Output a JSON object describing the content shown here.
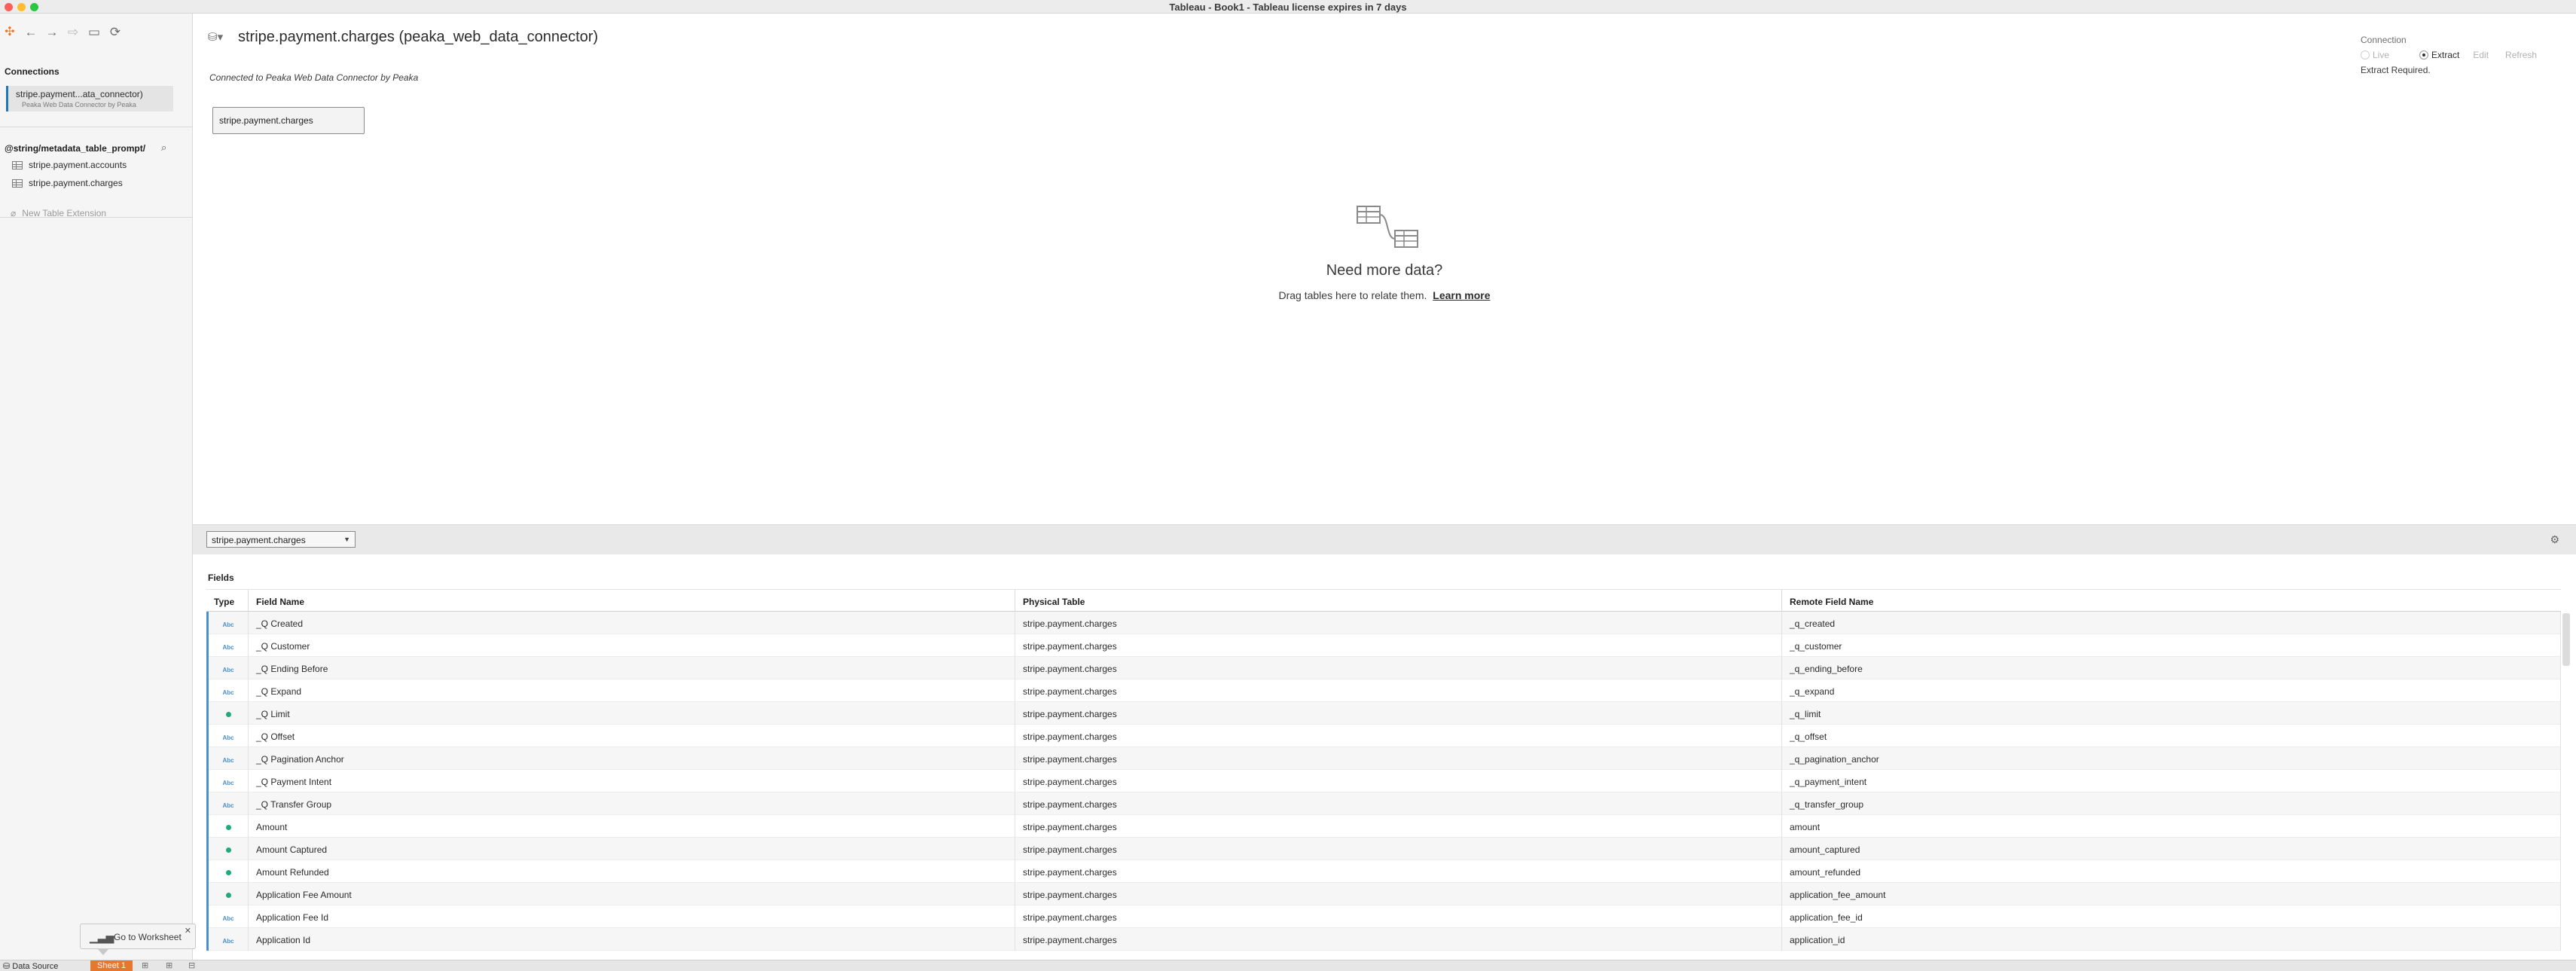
{
  "window": {
    "title": "Tableau - Book1 - Tableau license expires in 7 days"
  },
  "toolbar": {
    "icons": [
      "tableau-logo-icon",
      "back-icon",
      "forward-icon",
      "redo-icon",
      "save-icon",
      "refresh-icon"
    ]
  },
  "sidebar": {
    "connections_label": "Connections",
    "connection": {
      "name": "stripe.payment...ata_connector)",
      "subtitle": "Peaka Web Data Connector by Peaka"
    },
    "database_label": "@string/metadata_table_prompt/",
    "tables": [
      {
        "label": "stripe.payment.accounts"
      },
      {
        "label": "stripe.payment.charges"
      }
    ],
    "new_extension_label": "New Table Extension"
  },
  "header": {
    "title": "stripe.payment.charges (peaka_web_data_connector)",
    "connected_to": "Connected to Peaka Web Data Connector by Peaka"
  },
  "connection_panel": {
    "label": "Connection",
    "live": "Live",
    "extract": "Extract",
    "edit": "Edit",
    "refresh": "Refresh",
    "selected": "Extract",
    "status": "Extract Required."
  },
  "canvas": {
    "table_card": "stripe.payment.charges",
    "empty_title": "Need more data?",
    "empty_sub": "Drag tables here to relate them.",
    "learn_more": "Learn more"
  },
  "grid": {
    "table_select": "stripe.payment.charges",
    "fields_label": "Fields",
    "columns": [
      "Type",
      "Field Name",
      "Physical Table",
      "Remote Field Name"
    ],
    "rows": [
      {
        "type": "Abc",
        "field": "_Q Created",
        "physical": "stripe.payment.charges",
        "remote": "_q_created"
      },
      {
        "type": "Abc",
        "field": "_Q Customer",
        "physical": "stripe.payment.charges",
        "remote": "_q_customer"
      },
      {
        "type": "Abc",
        "field": "_Q Ending Before",
        "physical": "stripe.payment.charges",
        "remote": "_q_ending_before"
      },
      {
        "type": "Abc",
        "field": "_Q Expand",
        "physical": "stripe.payment.charges",
        "remote": "_q_expand"
      },
      {
        "type": "#",
        "field": "_Q Limit",
        "physical": "stripe.payment.charges",
        "remote": "_q_limit"
      },
      {
        "type": "Abc",
        "field": "_Q Offset",
        "physical": "stripe.payment.charges",
        "remote": "_q_offset"
      },
      {
        "type": "Abc",
        "field": "_Q Pagination Anchor",
        "physical": "stripe.payment.charges",
        "remote": "_q_pagination_anchor"
      },
      {
        "type": "Abc",
        "field": "_Q Payment Intent",
        "physical": "stripe.payment.charges",
        "remote": "_q_payment_intent"
      },
      {
        "type": "Abc",
        "field": "_Q Transfer Group",
        "physical": "stripe.payment.charges",
        "remote": "_q_transfer_group"
      },
      {
        "type": "#",
        "field": "Amount",
        "physical": "stripe.payment.charges",
        "remote": "amount"
      },
      {
        "type": "#",
        "field": "Amount Captured",
        "physical": "stripe.payment.charges",
        "remote": "amount_captured"
      },
      {
        "type": "#",
        "field": "Amount Refunded",
        "physical": "stripe.payment.charges",
        "remote": "amount_refunded"
      },
      {
        "type": "#",
        "field": "Application Fee Amount",
        "physical": "stripe.payment.charges",
        "remote": "application_fee_amount"
      },
      {
        "type": "Abc",
        "field": "Application Fee Id",
        "physical": "stripe.payment.charges",
        "remote": "application_fee_id"
      },
      {
        "type": "Abc",
        "field": "Application Id",
        "physical": "stripe.payment.charges",
        "remote": "application_id"
      }
    ]
  },
  "tooltip": {
    "text": "Go to Worksheet"
  },
  "bottom_tabs": {
    "data_source": "Data Source",
    "sheet": "Sheet 1"
  },
  "colors": {
    "accent": "#e8762d",
    "selection": "#1f77b4",
    "number_type": "#1eaa7c",
    "string_type": "#4b8ec9"
  }
}
